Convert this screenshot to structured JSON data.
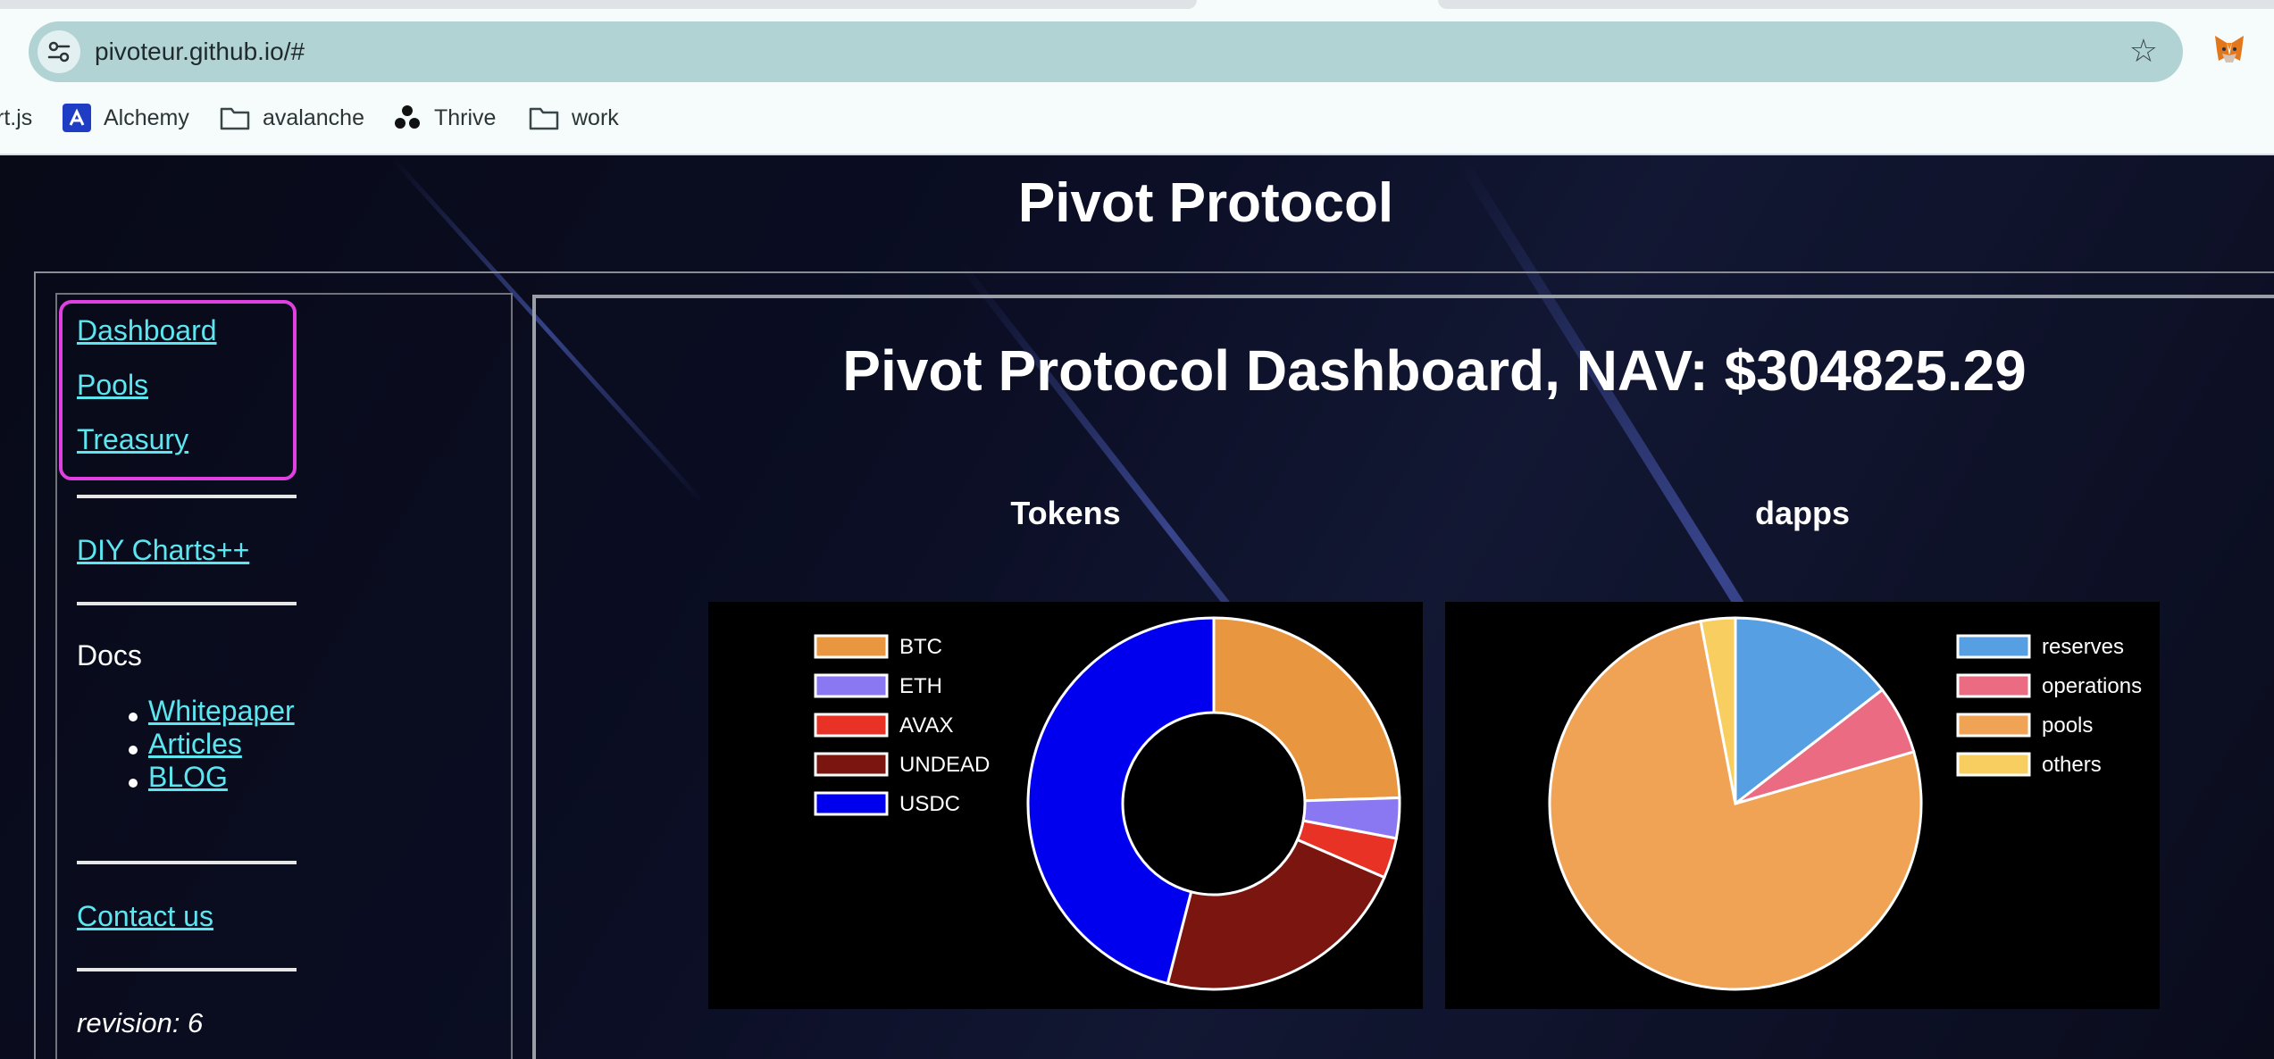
{
  "browser": {
    "url": "pivoteur.github.io/#",
    "bookmarks": [
      {
        "label": "rt.js",
        "icon": "none"
      },
      {
        "label": "Alchemy",
        "icon": "alchemy-logo-icon"
      },
      {
        "label": "avalanche",
        "icon": "folder-icon"
      },
      {
        "label": "Thrive",
        "icon": "thrive-logo-icon"
      },
      {
        "label": "work",
        "icon": "folder-icon"
      }
    ]
  },
  "site": {
    "title": "Pivot Protocol"
  },
  "sidebar": {
    "nav": [
      "Dashboard",
      "Pools",
      "Treasury"
    ],
    "diy": "DIY Charts++",
    "docs_label": "Docs",
    "docs_links": [
      "Whitepaper",
      "Articles",
      "BLOG"
    ],
    "contact": "Contact us",
    "revision": "revision: 6"
  },
  "dashboard": {
    "title": "Pivot Protocol Dashboard, NAV: $304825.29"
  },
  "chart_data": [
    {
      "type": "pie",
      "variant": "doughnut",
      "title": "Tokens",
      "legend_position": "left",
      "categories": [
        "BTC",
        "ETH",
        "AVAX",
        "UNDEAD",
        "USDC"
      ],
      "values": [
        24.5,
        3.5,
        3.5,
        22.5,
        46.0
      ],
      "colors": [
        "#e8963f",
        "#8a78f2",
        "#e83226",
        "#7b1510",
        "#0000ef"
      ]
    },
    {
      "type": "pie",
      "title": "dapps",
      "legend_position": "right",
      "categories": [
        "reserves",
        "operations",
        "pools",
        "others"
      ],
      "values": [
        14.5,
        6.0,
        76.5,
        3.0
      ],
      "colors": [
        "#579fe3",
        "#eb6b82",
        "#f0a355",
        "#f7ce5f"
      ]
    }
  ]
}
